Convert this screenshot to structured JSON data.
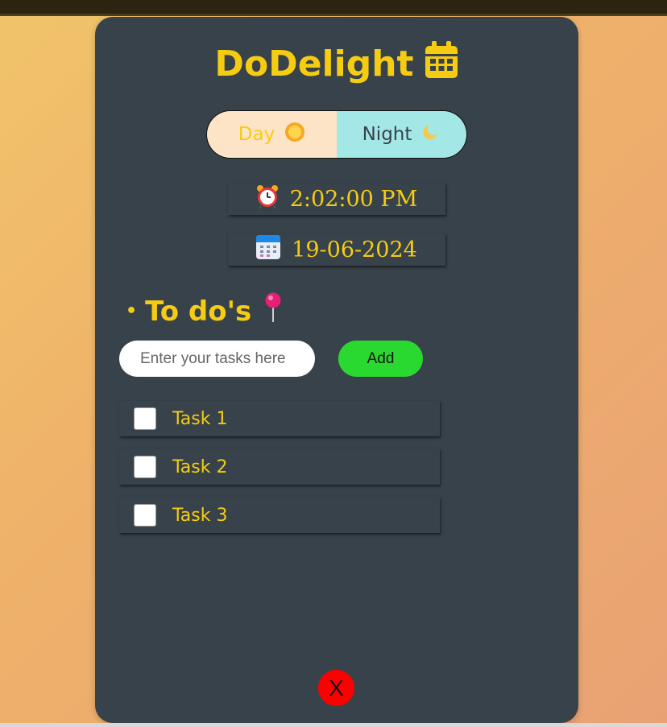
{
  "app": {
    "title": "DoDelight"
  },
  "theme_toggle": {
    "day_label": "Day",
    "night_label": "Night"
  },
  "clock": {
    "time": "2:02:00 PM"
  },
  "calendar": {
    "date": "19-06-2024"
  },
  "todos": {
    "heading": "To do's",
    "bullet": "•",
    "input_placeholder": "Enter your tasks here",
    "input_value": "",
    "add_label": "Add",
    "tasks": [
      {
        "label": "Task 1",
        "checked": false
      },
      {
        "label": "Task 2",
        "checked": false
      },
      {
        "label": "Task 3",
        "checked": false
      }
    ]
  },
  "close_label": "X",
  "colors": {
    "accent": "#f6cc13",
    "card": "#37424a",
    "add_button": "#2ad930",
    "close_button": "#ff0000",
    "day_bg": "#fee4c6",
    "night_bg": "#a3e8e6"
  },
  "icons": {
    "title_icon": "calendar-icon",
    "day_icon": "sun-icon",
    "night_icon": "moon-icon",
    "clock_icon": "alarm-clock-icon",
    "date_icon": "calendar-icon",
    "heading_icon": "pushpin-icon"
  }
}
